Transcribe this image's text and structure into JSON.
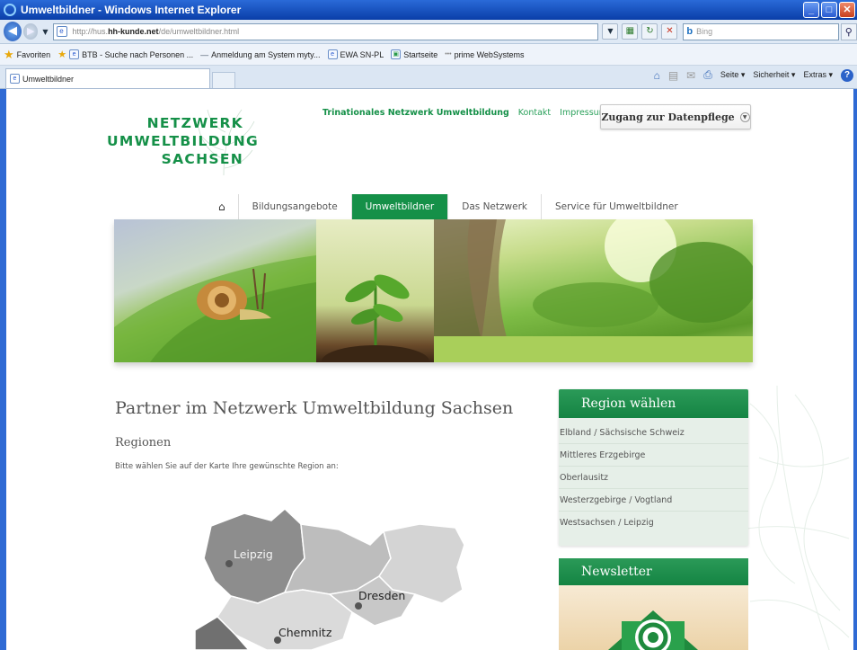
{
  "browser": {
    "window_title": "Umweltbildner - Windows Internet Explorer",
    "address": {
      "scheme_path_prefix": "http://hus.",
      "host": "hh-kunde.net",
      "path": "/de/umweltbildner.html"
    },
    "search": {
      "placeholder": "Bing",
      "engine": "Bing"
    },
    "favorites_label": "Favoriten",
    "favorites": [
      "BTB - Suche nach Personen ...",
      "Anmeldung am System myty...",
      "EWA SN-PL",
      "Startseite",
      "prime WebSystems"
    ],
    "tab_title": "Umweltbildner",
    "commands": [
      "Seite",
      "Sicherheit",
      "Extras"
    ]
  },
  "site": {
    "logo": {
      "line1": "NETZWERK",
      "line2": "UMWELTBILDUNG",
      "line3": "SACHSEN"
    },
    "topnav": {
      "title": "Trinationales Netzwerk Umweltbildung",
      "kontakt": "Kontakt",
      "impressum": "Impressum"
    },
    "login_button": "Zugang zur Datenpflege",
    "mainnav": [
      "Bildungsangebote",
      "Umweltbildner",
      "Das Netzwerk",
      "Service für Umweltbildner"
    ],
    "active_nav": "Umweltbildner",
    "heading": "Partner im Netzwerk Umweltbildung Sachsen",
    "subheading": "Regionen",
    "intro": "Bitte wählen Sie auf der Karte Ihre gewünschte Region an:",
    "map_labels": {
      "leipzig": "Leipzig",
      "dresden": "Dresden",
      "chemnitz": "Chemnitz"
    },
    "region_panel": {
      "title": "Region wählen",
      "regions": [
        "Elbland / Sächsische Schweiz",
        "Mittleres Erzgebirge",
        "Oberlausitz",
        "Westerzgebirge / Vogtland",
        "Westsachsen / Leipzig"
      ]
    },
    "newsletter": {
      "title": "Newsletter"
    },
    "colors": {
      "brand_green": "#159048",
      "panel_bg": "#e6efe8",
      "ie_blue": "#2f6ad4"
    }
  }
}
